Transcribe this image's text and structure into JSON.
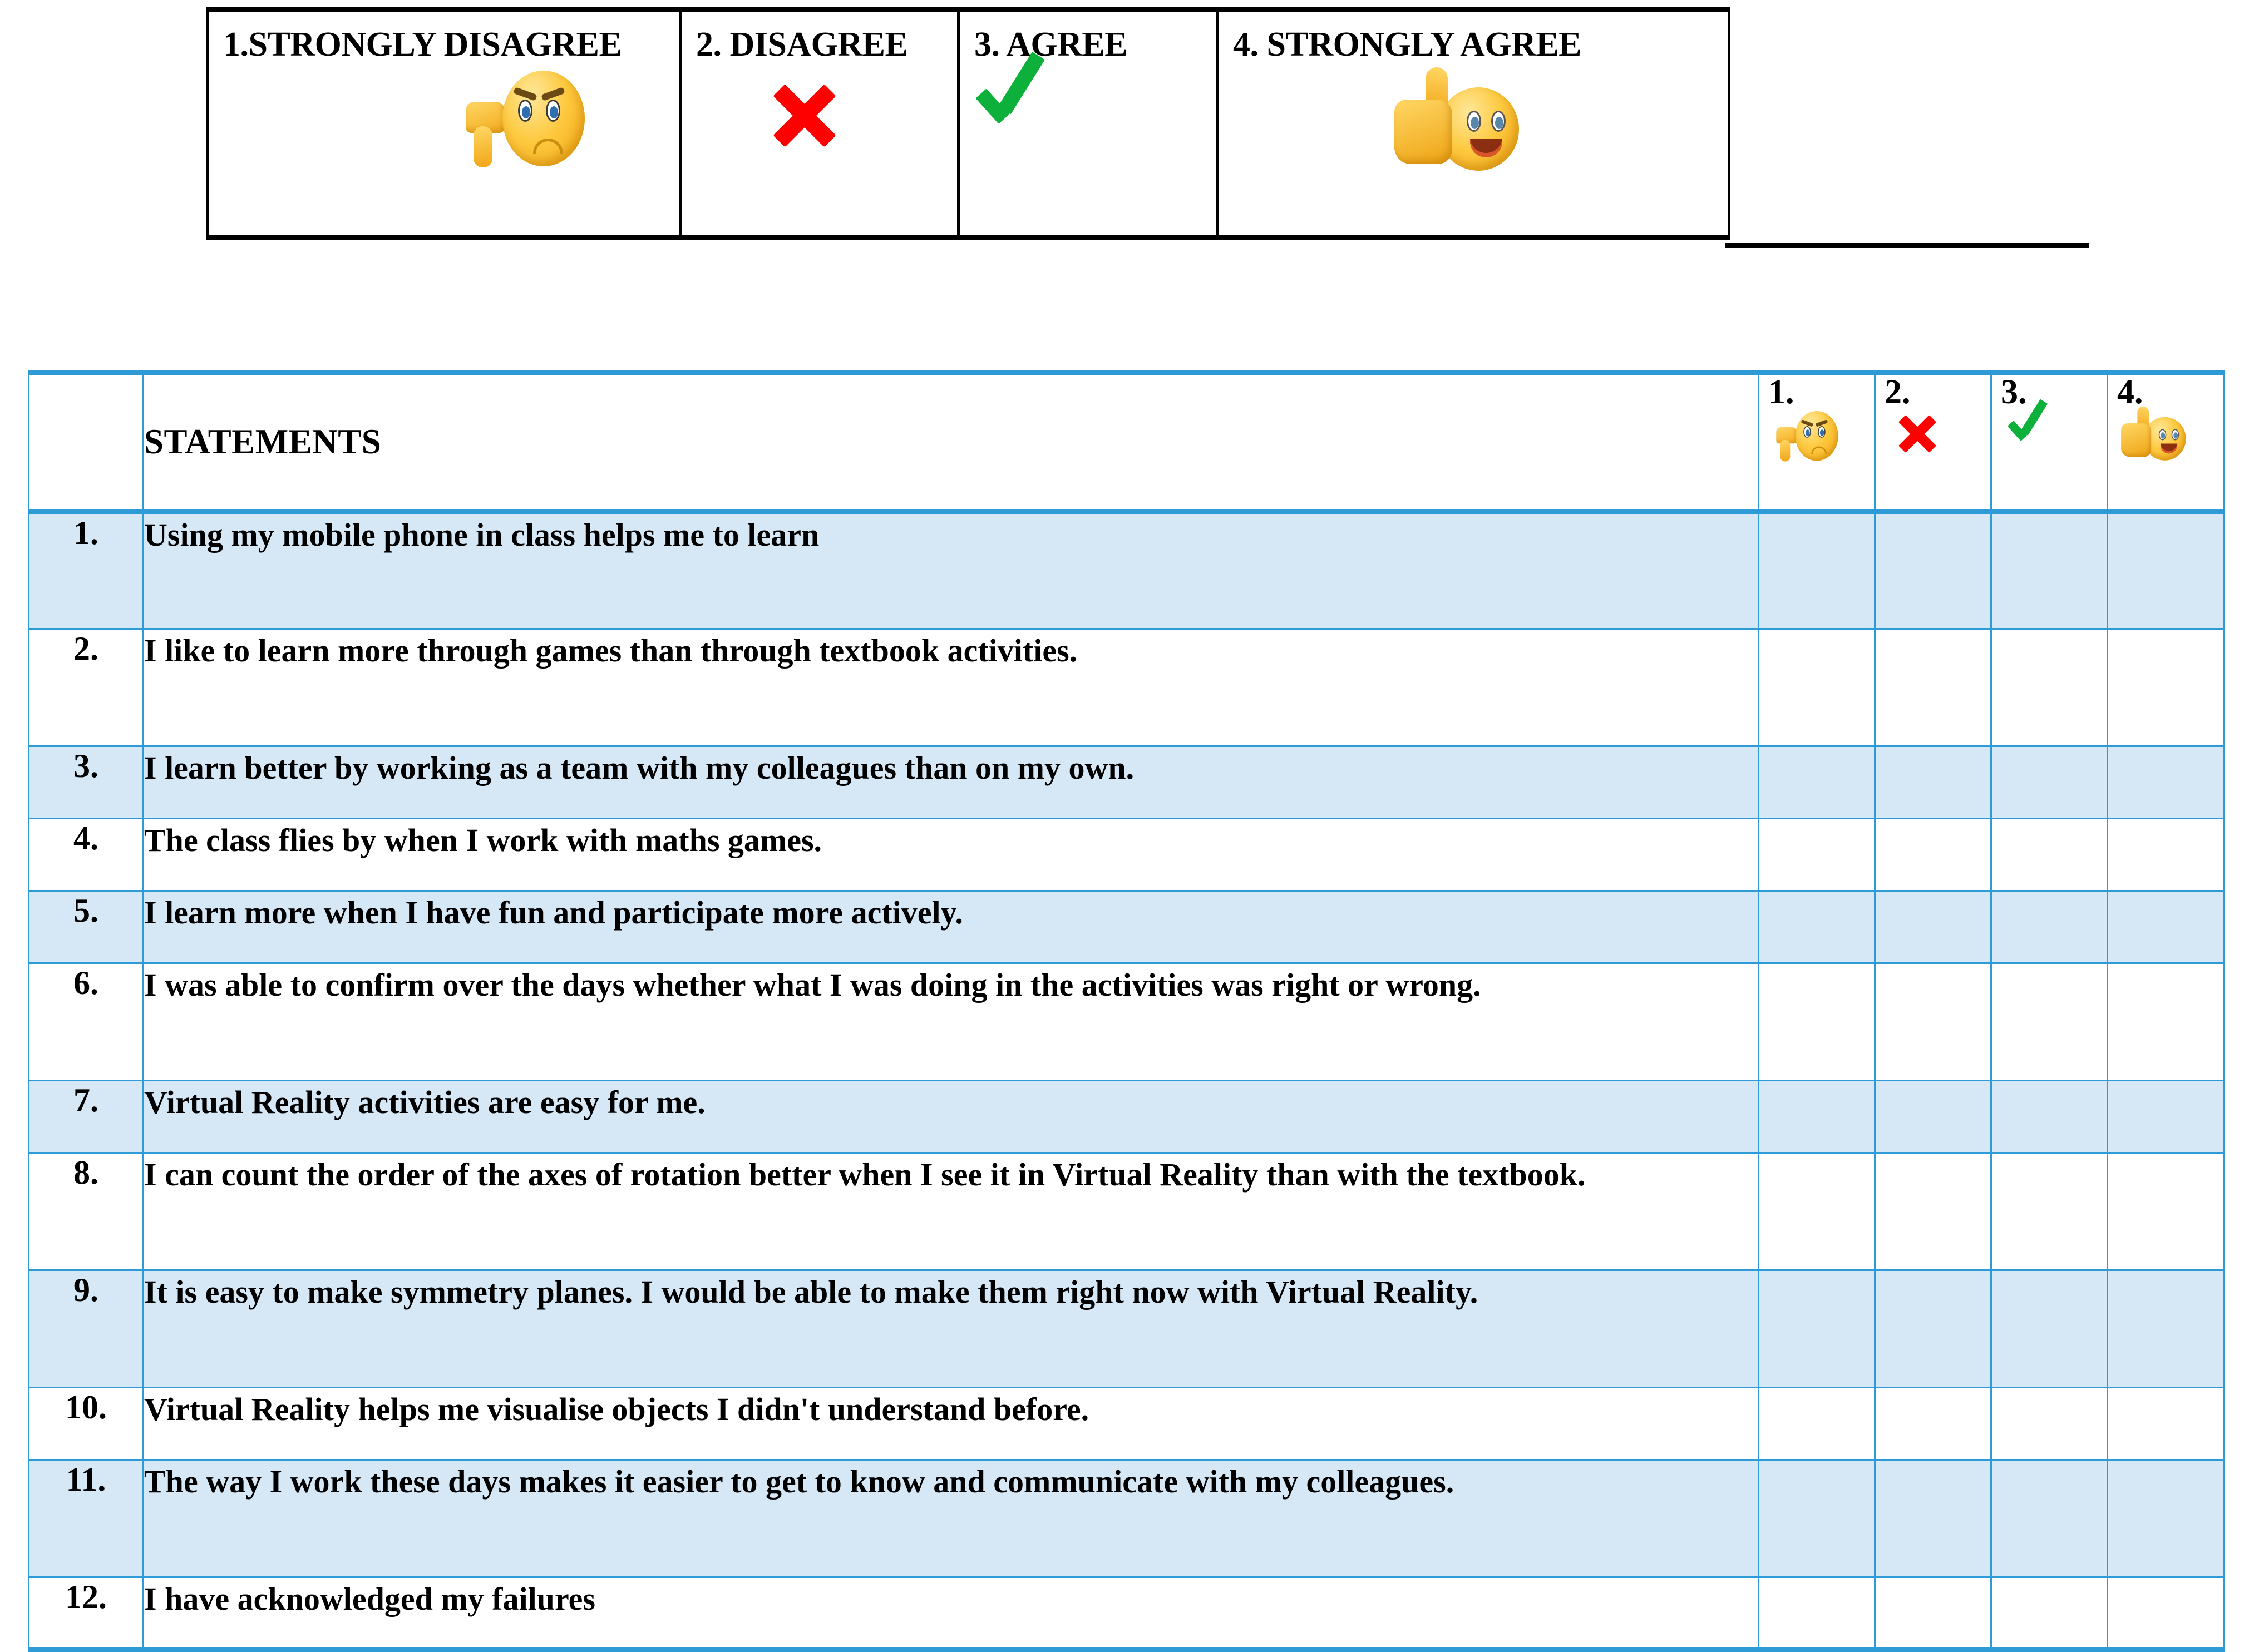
{
  "legend": {
    "items": [
      {
        "label": "1.STRONGLY DISAGREE",
        "icon": "thumbs-down-sad-face-emoji"
      },
      {
        "label": "2. DISAGREE",
        "icon": "red-cross-mark-icon"
      },
      {
        "label": "3. AGREE",
        "icon": "green-check-mark-icon"
      },
      {
        "label": "4. STRONGLY AGREE",
        "icon": "thumbs-up-happy-face-emoji"
      }
    ]
  },
  "survey": {
    "statements_header": "STATEMENTS",
    "rating_headers": [
      {
        "number": "1.",
        "icon": "thumbs-down-sad-face-emoji"
      },
      {
        "number": "2.",
        "icon": "red-cross-mark-icon"
      },
      {
        "number": "3.",
        "icon": "green-check-mark-icon"
      },
      {
        "number": "4.",
        "icon": "thumbs-up-happy-face-emoji"
      }
    ],
    "rows": [
      {
        "number": "1.",
        "text": "Using my mobile phone in class helps me to learn"
      },
      {
        "number": "2.",
        "text": "I like to learn more through games than through textbook activities."
      },
      {
        "number": "3.",
        "text": "I learn better by working as a team with my colleagues than on my own."
      },
      {
        "number": "4.",
        "text": "The class flies by when I work with maths games."
      },
      {
        "number": "5.",
        "text": "I learn more when I have fun and participate more actively."
      },
      {
        "number": "6.",
        "text": "I was able to confirm over the days whether what I was doing in the activities was right or wrong."
      },
      {
        "number": "7.",
        "text": "Virtual Reality activities are easy for me."
      },
      {
        "number": "8.",
        "text": "I can count the order of the axes of rotation better when I see it in Virtual Reality than with the textbook."
      },
      {
        "number": "9.",
        "text": "It is easy to make symmetry planes. I would be able to make them right now with Virtual Reality."
      },
      {
        "number": "10.",
        "text": "Virtual Reality helps me visualise objects I didn't understand before."
      },
      {
        "number": "11.",
        "text": "The way I work these days makes it easier to get to know and communicate with my colleagues."
      },
      {
        "number": "12.",
        "text": "I have acknowledged my failures"
      }
    ]
  },
  "colors": {
    "table_border_blue": "#2E9BD6",
    "row_fill_blue": "#D6E7F5",
    "legend_border_black": "#000000",
    "cross_red": "#FF0000",
    "check_green": "#0CB03A",
    "emoji_yellow": "#FDC93F"
  }
}
